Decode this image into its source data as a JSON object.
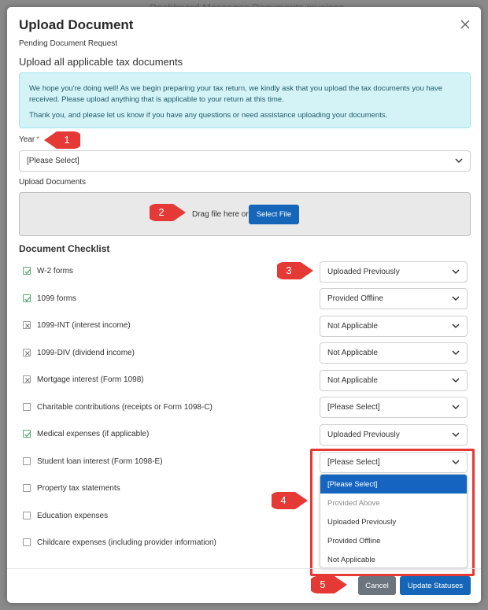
{
  "backdrop": {
    "text": "Dashboard  Messages  Documents  Invoices"
  },
  "modal": {
    "title": "Upload Document",
    "subtitle": "Pending Document Request",
    "heading": "Upload all applicable tax documents",
    "info_p1": "We hope you're doing well! As we begin preparing your tax return, we kindly ask that you upload the tax documents you have received. Please upload anything that is applicable to your return at this time.",
    "info_p2": "Thank you, and please let us know if you have any questions or need assistance uploading your documents."
  },
  "year": {
    "label": "Year",
    "required_mark": "*",
    "value": "[Please Select]"
  },
  "upload": {
    "label": "Upload Documents",
    "drag_text": "Drag file here or",
    "button": "Select File"
  },
  "checklist": {
    "heading": "Document Checklist",
    "items": [
      {
        "label": "W-2 forms",
        "state": "checked",
        "status": "Uploaded Previously"
      },
      {
        "label": "1099 forms",
        "state": "checked",
        "status": "Provided Offline"
      },
      {
        "label": "1099-INT (interest income)",
        "state": "na",
        "status": "Not Applicable"
      },
      {
        "label": "1099-DIV (dividend income)",
        "state": "na",
        "status": "Not Applicable"
      },
      {
        "label": "Mortgage interest (Form 1098)",
        "state": "na",
        "status": "Not Applicable"
      },
      {
        "label": "Charitable contributions (receipts or Form 1098-C)",
        "state": "empty",
        "status": "[Please Select]"
      },
      {
        "label": "Medical expenses (if applicable)",
        "state": "checked",
        "status": "Uploaded Previously"
      },
      {
        "label": "Student loan interest (Form 1098-E)",
        "state": "empty",
        "status": "[Please Select]"
      },
      {
        "label": "Property tax statements",
        "state": "empty",
        "status": ""
      },
      {
        "label": "Education expenses",
        "state": "empty",
        "status": ""
      },
      {
        "label": "Childcare expenses (including provider information)",
        "state": "empty",
        "status": ""
      }
    ]
  },
  "dropdown": {
    "options": [
      "[Please Select]",
      "Provided Above",
      "Uploaded Previously",
      "Provided Offline",
      "Not Applicable"
    ]
  },
  "footer": {
    "cancel": "Cancel",
    "update": "Update Statuses"
  },
  "markers": [
    "1",
    "2",
    "3",
    "4",
    "5"
  ],
  "colors": {
    "primary": "#1565b8",
    "marker": "#e53935",
    "info_bg": "#d4f3f7",
    "check": "#5aa97c"
  }
}
